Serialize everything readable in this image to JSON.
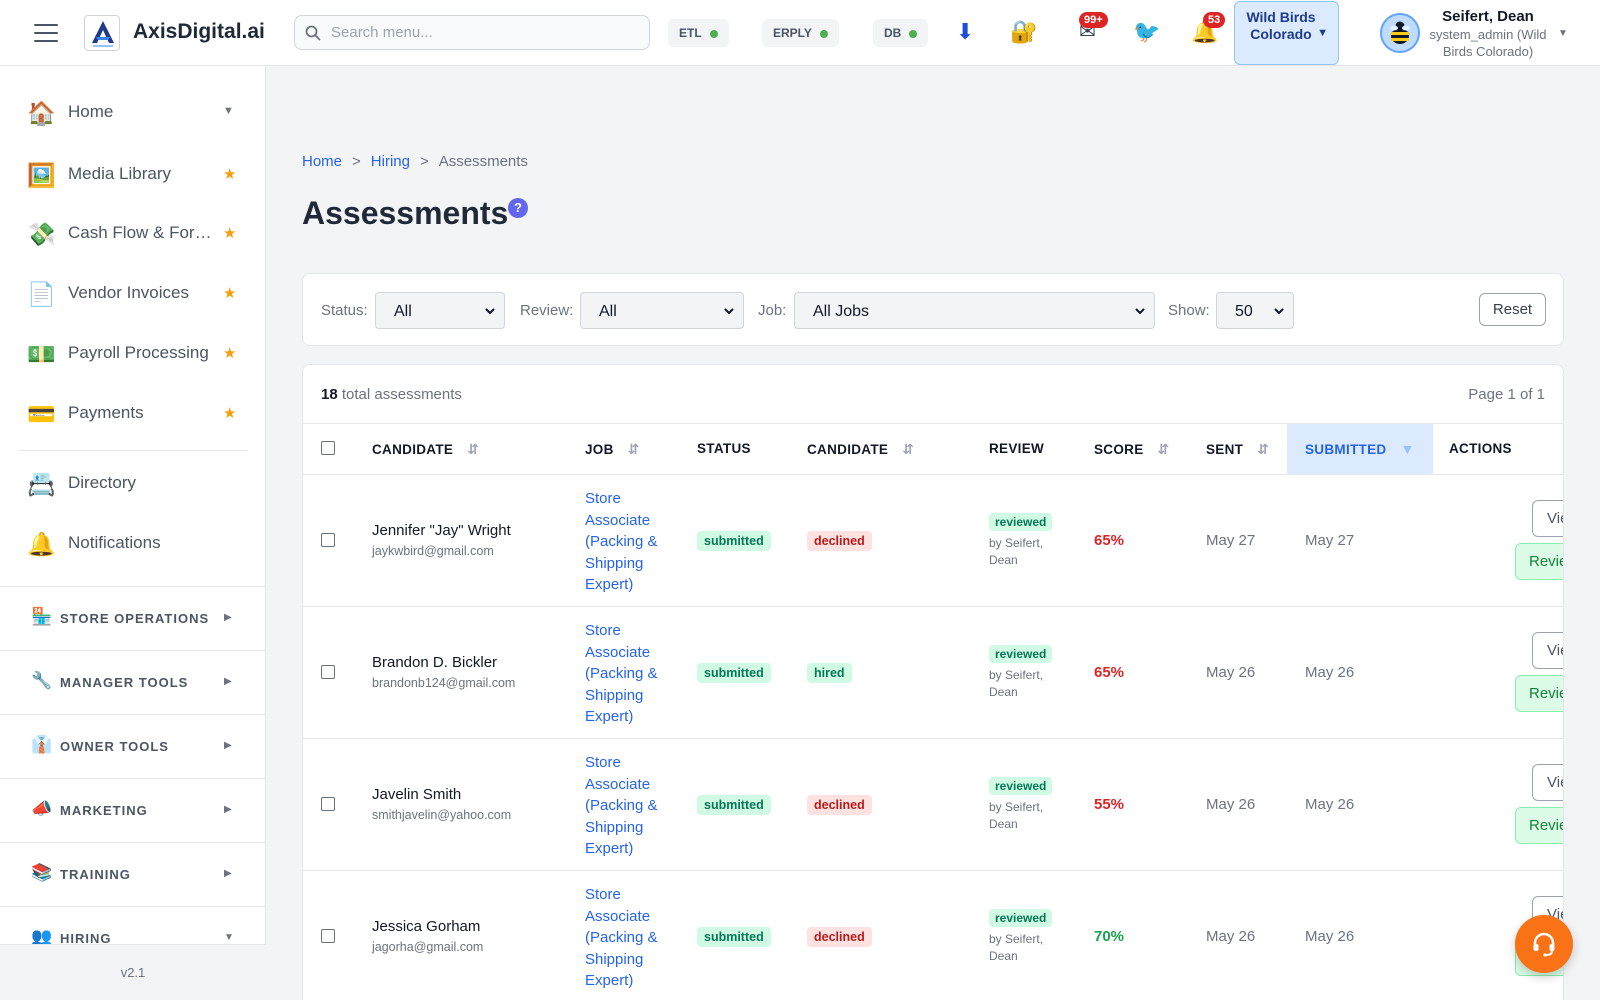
{
  "header": {
    "app_title": "AxisDigital.ai",
    "search_placeholder": "Search menu...",
    "status_pills": [
      {
        "label": "ETL",
        "status_color": "#4caf50"
      },
      {
        "label": "ERPLY",
        "status_color": "#4caf50"
      },
      {
        "label": "DB",
        "status_color": "#4caf50"
      }
    ],
    "icons": [
      "download-icon",
      "lock-key-icon",
      "mail-icon",
      "twitter-icon",
      "bell-icon"
    ],
    "mail_badge": "99+",
    "bell_badge": "53",
    "org_selector": "Wild Birds Colorado",
    "user_name": "Seifert, Dean",
    "user_role": "system_admin (Wild Birds Colorado)"
  },
  "sidebar": {
    "items": [
      {
        "label": "Home",
        "icon": "house-icon",
        "marker": "caret"
      },
      {
        "label": "Media Library",
        "icon": "picture-icon",
        "marker": "star"
      },
      {
        "label": "Cash Flow & Forecasting",
        "icon": "money-wings-icon",
        "marker": "star"
      },
      {
        "label": "Vendor Invoices",
        "icon": "document-icon",
        "marker": "star"
      },
      {
        "label": "Payroll Processing",
        "icon": "dollar-bill-icon",
        "marker": "star"
      },
      {
        "label": "Payments",
        "icon": "credit-card-icon",
        "marker": "star"
      },
      {
        "label": "Directory",
        "icon": "rolodex-icon",
        "marker": "none"
      },
      {
        "label": "Notifications",
        "icon": "bell-icon",
        "marker": "none"
      }
    ],
    "sections": [
      {
        "label": "STORE OPERATIONS",
        "icon": "store-icon"
      },
      {
        "label": "MANAGER TOOLS",
        "icon": "wrench-icon"
      },
      {
        "label": "OWNER TOOLS",
        "icon": "necktie-icon"
      },
      {
        "label": "MARKETING",
        "icon": "megaphone-icon"
      },
      {
        "label": "TRAINING",
        "icon": "books-icon"
      },
      {
        "label": "HIRING",
        "icon": "people-icon"
      }
    ],
    "version": "v2.1"
  },
  "breadcrumb": {
    "home": "Home",
    "hiring": "Hiring",
    "current": "Assessments",
    "separator": ">"
  },
  "page_title": "Assessments",
  "help_label": "?",
  "filters": {
    "status_label": "Status:",
    "status_value": "All",
    "review_label": "Review:",
    "review_value": "All",
    "job_label": "Job:",
    "job_value": "All Jobs",
    "show_label": "Show:",
    "show_value": "50",
    "reset_label": "Reset"
  },
  "summary": {
    "total_count": "18",
    "total_label": "total assessments",
    "page_info": "Page 1 of 1"
  },
  "columns": {
    "candidate": "CANDIDATE",
    "job": "JOB",
    "status": "STATUS",
    "candidate_status": "CANDIDATE",
    "review": "REVIEW",
    "score": "SCORE",
    "sent": "SENT",
    "submitted": "SUBMITTED",
    "actions": "ACTIONS"
  },
  "actions": {
    "view_label": "View",
    "review_label": "Review"
  },
  "rows": [
    {
      "name": "Jennifer \"Jay\" Wright",
      "email": "jaykwbird@gmail.com",
      "job": "Store Associate (Packing & Shipping Expert)",
      "status": "submitted",
      "candidate_status": "declined",
      "review": "reviewed",
      "review_by": "by Seifert, Dean",
      "score": "65%",
      "score_color": "#dc2626",
      "sent": "May 27",
      "submitted": "May 27"
    },
    {
      "name": "Brandon D. Bickler",
      "email": "brandonb124@gmail.com",
      "job": "Store Associate (Packing & Shipping Expert)",
      "status": "submitted",
      "candidate_status": "hired",
      "review": "reviewed",
      "review_by": "by Seifert, Dean",
      "score": "65%",
      "score_color": "#dc2626",
      "sent": "May 26",
      "submitted": "May 26"
    },
    {
      "name": "Javelin Smith",
      "email": "smithjavelin@yahoo.com",
      "job": "Store Associate (Packing & Shipping Expert)",
      "status": "submitted",
      "candidate_status": "declined",
      "review": "reviewed",
      "review_by": "by Seifert, Dean",
      "score": "55%",
      "score_color": "#dc2626",
      "sent": "May 26",
      "submitted": "May 26"
    },
    {
      "name": "Jessica Gorham",
      "email": "jagorha@gmail.com",
      "job": "Store Associate (Packing & Shipping Expert)",
      "status": "submitted",
      "candidate_status": "declined",
      "review": "reviewed",
      "review_by": "by Seifert, Dean",
      "score": "70%",
      "score_color": "#16a34a",
      "sent": "May 26",
      "submitted": "May 26"
    }
  ]
}
